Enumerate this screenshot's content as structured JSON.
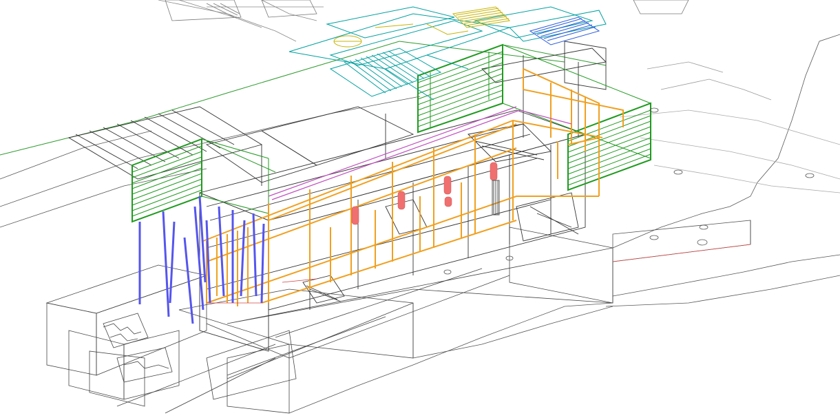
{
  "viewport": {
    "kind": "isometric-wireframe-cad-view",
    "background": "#ffffff"
  },
  "layers": [
    {
      "name": "terrain-and-massing",
      "color": "#4a4a4a"
    },
    {
      "name": "site-boundary",
      "color": "#2e9a2e"
    },
    {
      "name": "green-louver-screens",
      "color": "#1f9a1f"
    },
    {
      "name": "orange-structural-frame",
      "color": "#f0a020"
    },
    {
      "name": "blue-columns",
      "color": "#5555ee"
    },
    {
      "name": "red-cylinders",
      "color": "#f07070"
    },
    {
      "name": "magenta-rails",
      "color": "#c050c0"
    },
    {
      "name": "teal-roof-plan",
      "color": "#00a0a0"
    },
    {
      "name": "yellow-stair-plan",
      "color": "#c8b400"
    },
    {
      "name": "blue-stair-plan",
      "color": "#2a5adc"
    }
  ]
}
